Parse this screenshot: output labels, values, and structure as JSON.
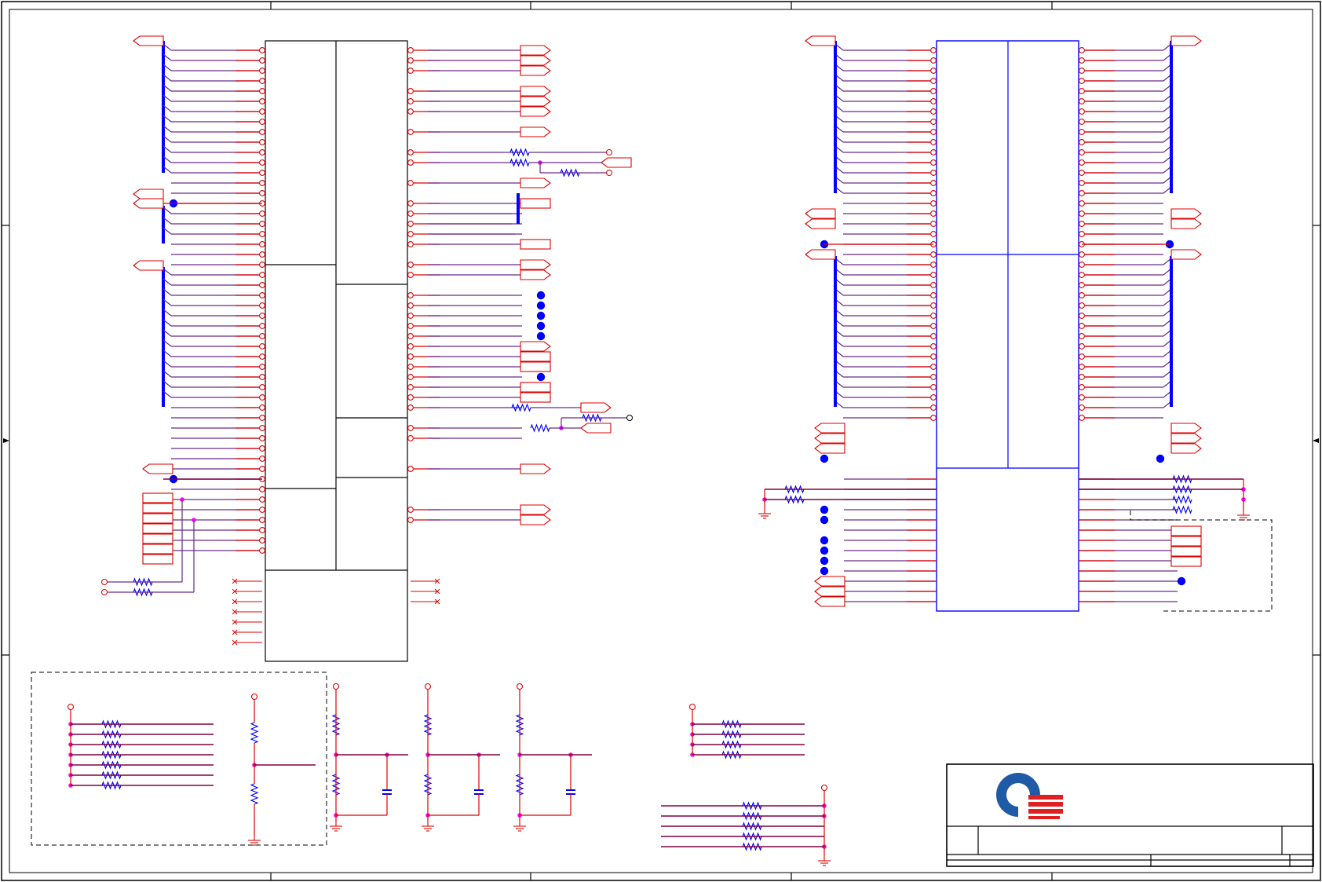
{
  "sheet": {
    "zone_count_x": 5,
    "zone_count_y": 4
  },
  "colors": {
    "wire_red": "#e00000",
    "wire_maroon": "#800040",
    "wire_purple": "#6a2a8a",
    "component_blue": "#0000ff",
    "junction_magenta": "#ff00ff",
    "bus_blue": "#0000ff",
    "logo_blue": "#1f5aa6",
    "logo_red": "#e02020",
    "frame_black": "#000000"
  },
  "components": {
    "left_ic": {
      "type": "multi-section IC symbol",
      "sections": 8
    },
    "right_ic": {
      "type": "multi-section IC symbol",
      "sections": 5
    },
    "resistor_networks": 3,
    "voltage_dividers": 3,
    "capacitors": 3,
    "ground_symbols": 9
  },
  "title_block": {
    "logo": "company-logo"
  }
}
